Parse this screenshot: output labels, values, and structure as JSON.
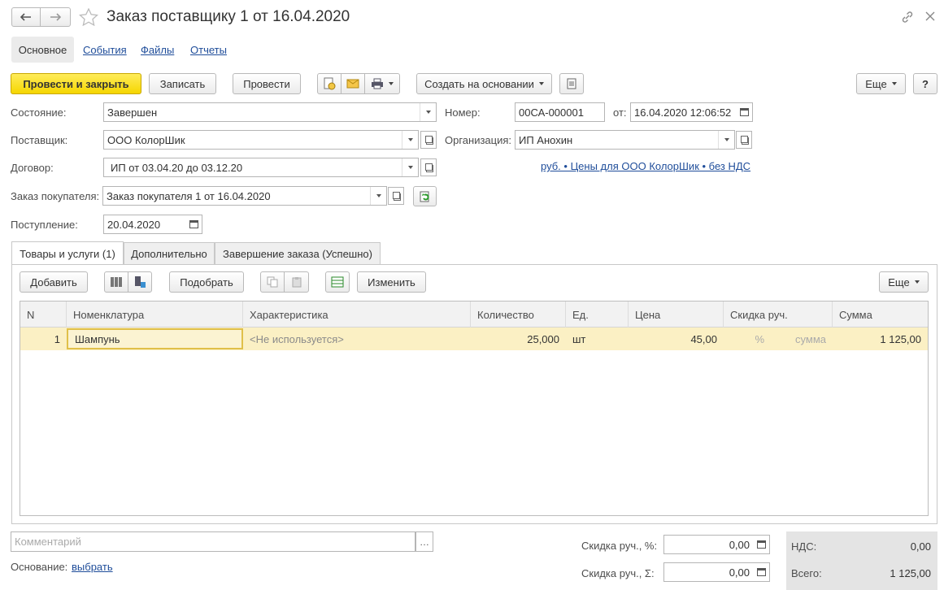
{
  "window": {
    "title": "Заказ поставщику 1 от 16.04.2020"
  },
  "nav_tabs": [
    {
      "label": "Основное"
    },
    {
      "label": "События"
    },
    {
      "label": "Файлы"
    },
    {
      "label": "Отчеты"
    }
  ],
  "toolbar": {
    "post_close": "Провести и закрыть",
    "save": "Записать",
    "post": "Провести",
    "create_based": "Создать на основании",
    "more": "Еще",
    "help": "?"
  },
  "form": {
    "state": {
      "label": "Состояние:",
      "value": "Завершен"
    },
    "supplier": {
      "label": "Поставщик:",
      "value": "ООО КолорШик"
    },
    "contract": {
      "label": "Договор:",
      "value": "ИП от 03.04.20 до 03.12.20"
    },
    "customer_order": {
      "label": "Заказ покупателя:",
      "value": "Заказ покупателя 1 от 16.04.2020"
    },
    "receipt": {
      "label": "Поступление:",
      "value": "20.04.2020"
    },
    "number": {
      "label": "Номер:",
      "value": "00СА-000001"
    },
    "date": {
      "label": "от:",
      "value": "16.04.2020 12:06:52"
    },
    "organization": {
      "label": "Организация:",
      "value": "ИП Анохин"
    },
    "prices_link": "руб. • Цены для ООО КолорШик • без НДС"
  },
  "doc_tabs": [
    {
      "label": "Товары и услуги (1)"
    },
    {
      "label": "Дополнительно"
    },
    {
      "label": "Завершение заказа (Успешно)"
    }
  ],
  "table_toolbar": {
    "add": "Добавить",
    "pick": "Подобрать",
    "change": "Изменить",
    "more": "Еще"
  },
  "table": {
    "columns": [
      "N",
      "Номенклатура",
      "Характеристика",
      "Количество",
      "Ед.",
      "Цена",
      "Скидка руч.",
      "Сумма"
    ],
    "rows": [
      {
        "n": "1",
        "item": "Шампунь",
        "char": "<Не используется>",
        "qty": "25,000",
        "unit": "шт",
        "price": "45,00",
        "disc_pct": "%",
        "disc_sum": "сумма",
        "sum": "1 125,00"
      }
    ]
  },
  "footer": {
    "comment_placeholder": "Комментарий",
    "basis_label": "Основание:",
    "basis_link": "выбрать",
    "disc_pct_label": "Скидка руч., %:",
    "disc_pct_value": "0,00",
    "disc_sum_label": "Скидка руч., Σ:",
    "disc_sum_value": "0,00",
    "vat_label": "НДС:",
    "vat_value": "0,00",
    "total_label": "Всего:",
    "total_value": "1 125,00"
  },
  "colors": {
    "accent_yellow": "#f5d600",
    "link_blue": "#1f4d9a",
    "selected_row": "#fbf0c4"
  }
}
